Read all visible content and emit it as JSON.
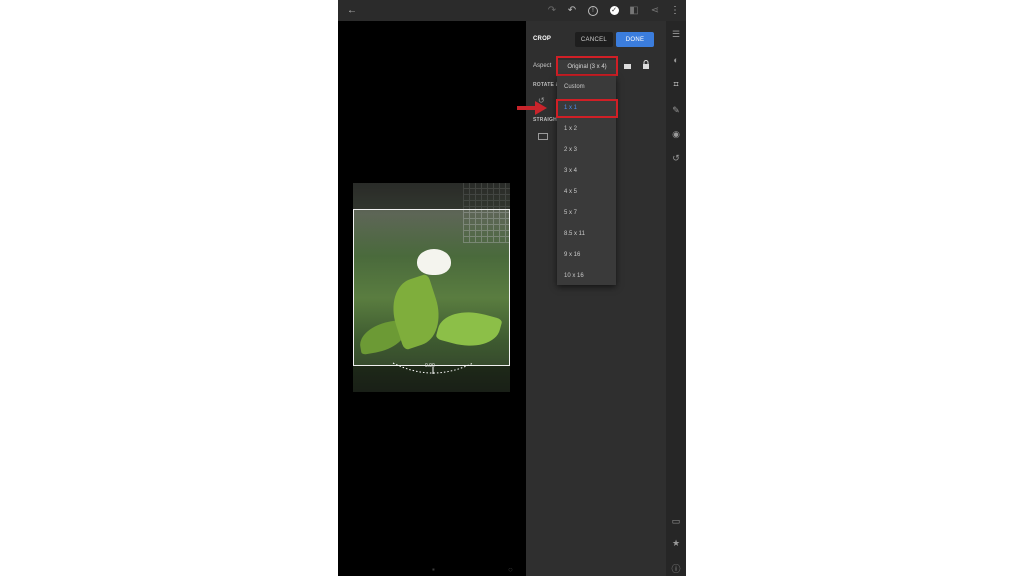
{
  "topbar": {
    "back": "←",
    "redo": "↷",
    "undo": "↶",
    "info": "!",
    "check": "✓",
    "compare": "◧",
    "share": "⋖",
    "more": "⋮"
  },
  "panel": {
    "title": "CROP",
    "cancel_label": "CANCEL",
    "done_label": "DONE",
    "aspect_label": "Aspect",
    "aspect_value": "Original (3 x 4)",
    "rotate_label": "ROTATE & ...",
    "straighten_label": "STRAIGH...",
    "dropdown": {
      "options": [
        {
          "label": "Custom",
          "selected": false
        },
        {
          "label": "1 x 1",
          "selected": true
        },
        {
          "label": "1 x 2",
          "selected": false
        },
        {
          "label": "2 x 3",
          "selected": false
        },
        {
          "label": "3 x 4",
          "selected": false
        },
        {
          "label": "4 x 5",
          "selected": false
        },
        {
          "label": "5 x 7",
          "selected": false
        },
        {
          "label": "8.5 x 11",
          "selected": false
        },
        {
          "label": "9 x 16",
          "selected": false
        },
        {
          "label": "10 x 16",
          "selected": false
        }
      ]
    }
  },
  "photo": {
    "dial_value": "0.00"
  },
  "rail_icons": [
    "sliders-icon",
    "color-icon",
    "crop-icon",
    "healing-icon",
    "presets-icon",
    "history-icon",
    "comment-icon",
    "star-icon",
    "info-icon"
  ],
  "colors": {
    "accent": "#3b7ddd",
    "highlight": "#d01f26",
    "selected_text": "#4a8ef0",
    "panel_bg": "#2f2f2f"
  }
}
